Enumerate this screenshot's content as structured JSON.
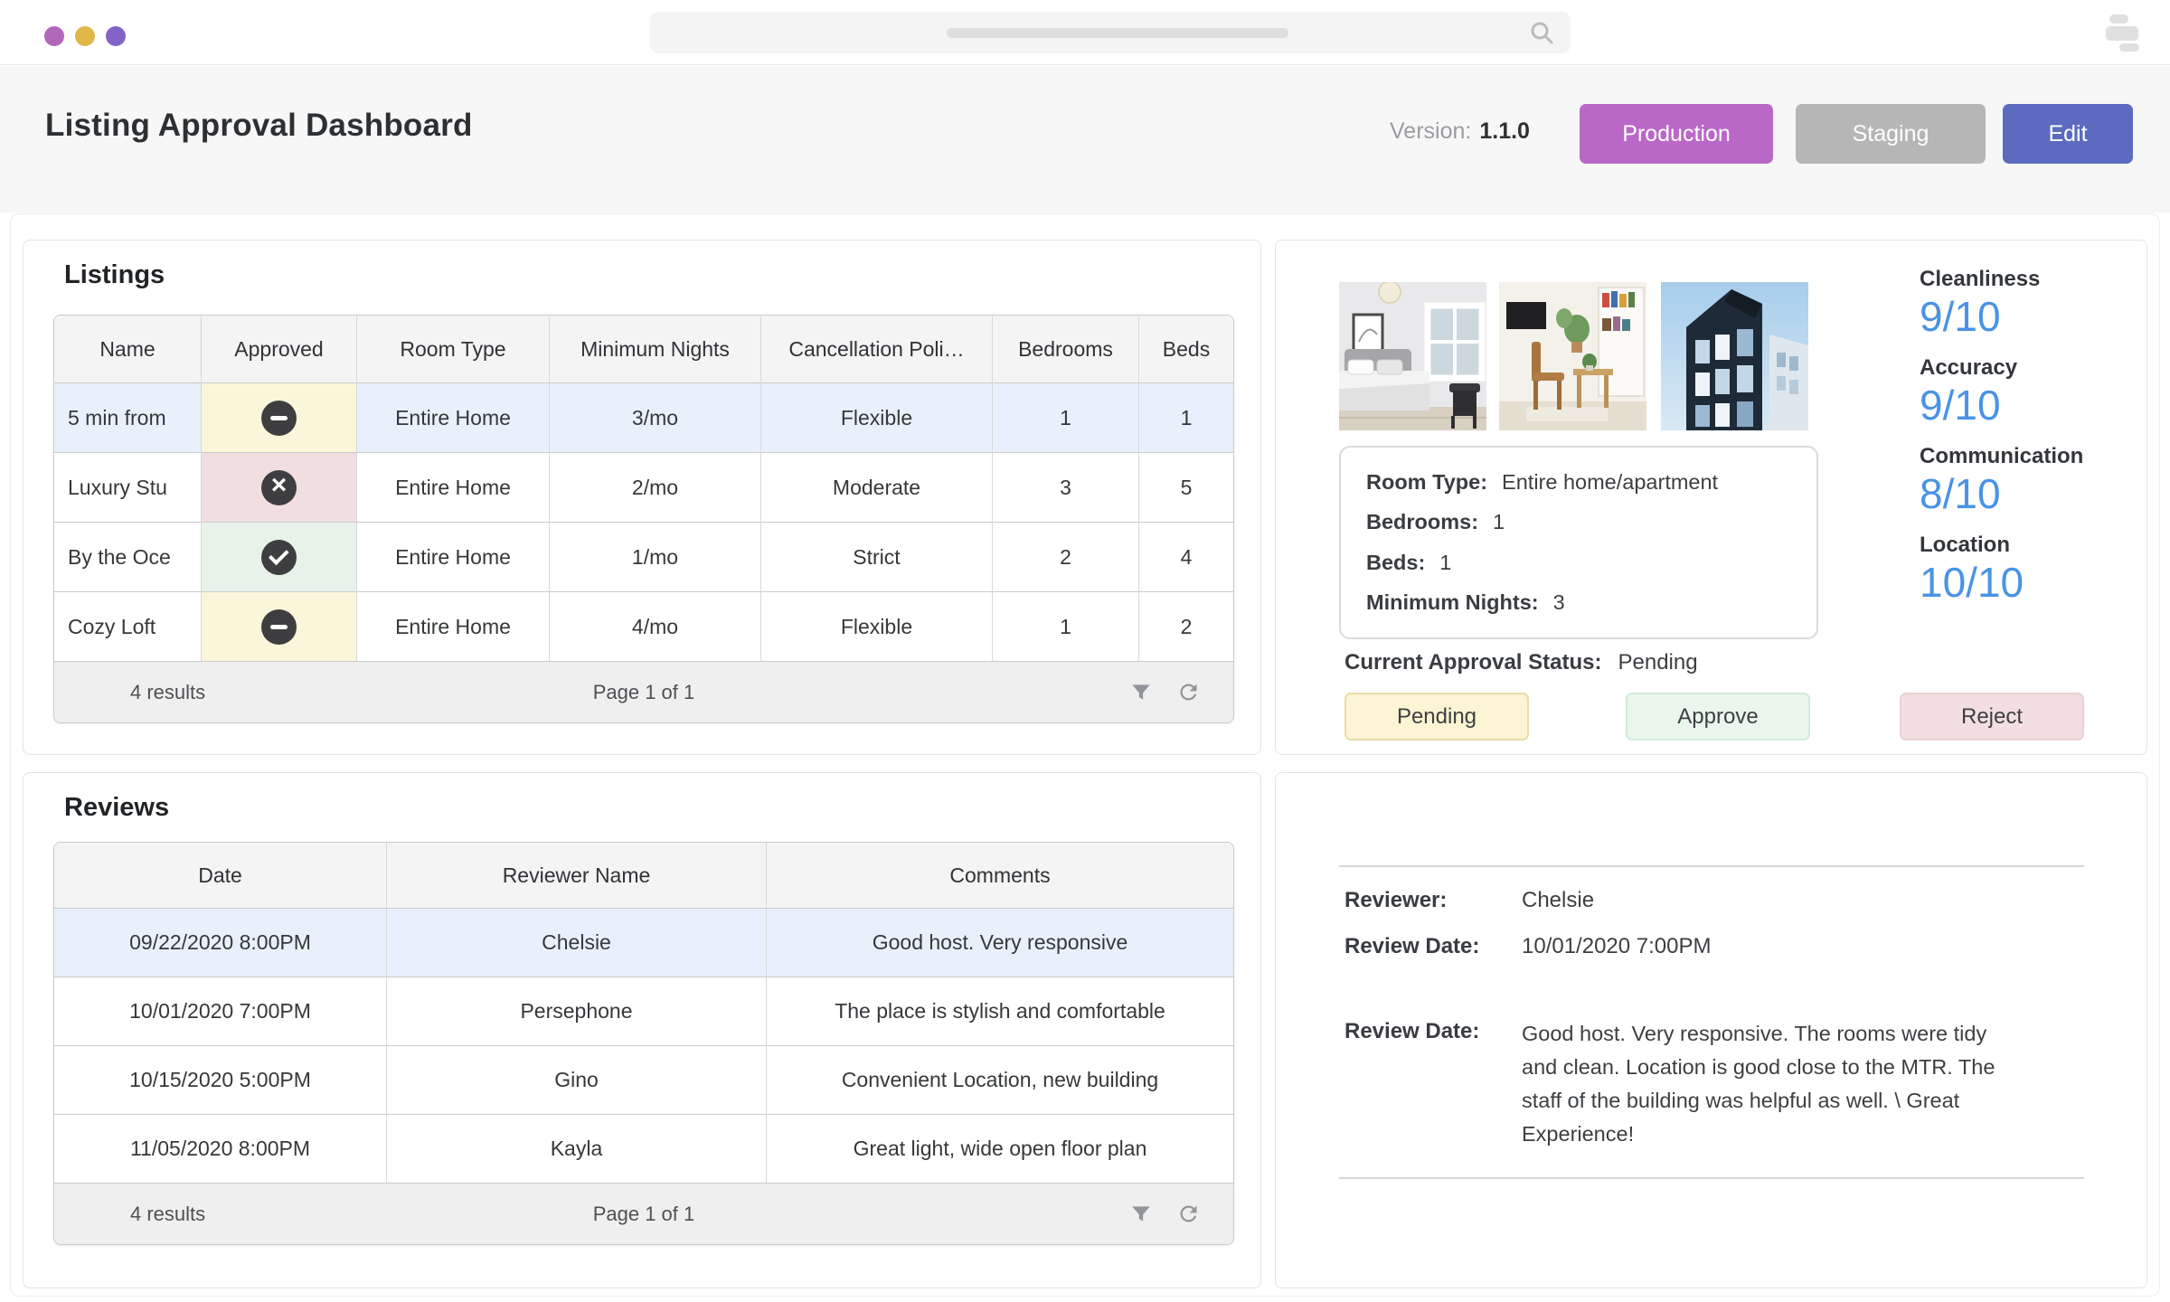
{
  "window": {
    "traffic_light_colors": [
      "#b168b8",
      "#e1b74a",
      "#8463c6"
    ],
    "search": {
      "value": "",
      "placeholder": ""
    }
  },
  "header": {
    "title": "Listing Approval Dashboard",
    "version_label": "Version:",
    "version_value": "1.1.0",
    "buttons": [
      {
        "label": "Production",
        "color": "#ba68c8"
      },
      {
        "label": "Staging",
        "color": "#b6b6b6"
      },
      {
        "label": "Edit",
        "color": "#5c6bc0"
      }
    ]
  },
  "listings": {
    "title": "Listings",
    "columns": [
      "Name",
      "Approved",
      "Room Type",
      "Minimum Nights",
      "Cancellation Poli…",
      "Bedrooms",
      "Beds"
    ],
    "rows": [
      {
        "name": "5 min from",
        "approved": "pending",
        "room_type": "Entire Home",
        "minimum_nights": "3/mo",
        "cancellation": "Flexible",
        "bedrooms": "1",
        "beds": "1",
        "selected": true
      },
      {
        "name": "Luxury Stu",
        "approved": "rejected",
        "room_type": "Entire Home",
        "minimum_nights": "2/mo",
        "cancellation": "Moderate",
        "bedrooms": "3",
        "beds": "5",
        "selected": false
      },
      {
        "name": "By the Oce",
        "approved": "approved",
        "room_type": "Entire Home",
        "minimum_nights": "1/mo",
        "cancellation": "Strict",
        "bedrooms": "2",
        "beds": "4",
        "selected": false
      },
      {
        "name": "Cozy Loft",
        "approved": "pending",
        "room_type": "Entire Home",
        "minimum_nights": "4/mo",
        "cancellation": "Flexible",
        "bedrooms": "1",
        "beds": "2",
        "selected": false
      }
    ],
    "footer": {
      "results": "4 results",
      "page": "Page 1 of 1"
    }
  },
  "reviews": {
    "title": "Reviews",
    "columns": [
      "Date",
      "Reviewer Name",
      "Comments"
    ],
    "rows": [
      {
        "date": "09/22/2020 8:00PM",
        "reviewer": "Chelsie",
        "comments": "Good host. Very responsive",
        "selected": true
      },
      {
        "date": "10/01/2020 7:00PM",
        "reviewer": "Persephone",
        "comments": "The place is stylish and comfortable",
        "selected": false
      },
      {
        "date": "10/15/2020 5:00PM",
        "reviewer": "Gino",
        "comments": "Convenient Location, new building",
        "selected": false
      },
      {
        "date": "11/05/2020 8:00PM",
        "reviewer": "Kayla",
        "comments": "Great light, wide open floor plan",
        "selected": false
      }
    ],
    "footer": {
      "results": "4 results",
      "page": "Page 1 of 1"
    }
  },
  "detail": {
    "photos": [
      "bedroom",
      "living-room",
      "building-exterior"
    ],
    "ratings": [
      {
        "label": "Cleanliness",
        "value": "9/10"
      },
      {
        "label": "Accuracy",
        "value": "9/10"
      },
      {
        "label": "Communication",
        "value": "8/10"
      },
      {
        "label": "Location",
        "value": "10/10"
      }
    ],
    "info": [
      {
        "label": "Room Type:",
        "value": "Entire home/apartment"
      },
      {
        "label": "Bedrooms:",
        "value": "1"
      },
      {
        "label": "Beds:",
        "value": "1"
      },
      {
        "label": "Minimum Nights:",
        "value": "3"
      }
    ],
    "status_label": "Current Approval Status:",
    "status_value": "Pending",
    "actions": [
      {
        "label": "Pending",
        "bg": "#fcf4d2"
      },
      {
        "label": "Approve",
        "bg": "#e9f7ec"
      },
      {
        "label": "Reject",
        "bg": "#f3dfe1"
      }
    ]
  },
  "review_detail": {
    "reviewer_label": "Reviewer:",
    "reviewer_value": "Chelsie",
    "date_label": "Review Date:",
    "date_value": "10/01/2020 7:00PM",
    "comment_label": "Review Date:",
    "comment_value": "Good host. Very responsive. The rooms were tidy and clean. Location is good close to the MTR. The staff of the building was helpful as well. \\ Great Experience!"
  },
  "colors": {
    "accent_blue": "#4a93e6",
    "selected_row": "#e8f1fb",
    "status_pending_bg": "#fbf5da",
    "status_rejected_bg": "#f1dee1",
    "status_approved_bg": "#e7f3e9",
    "status_icon_circle": "#3e3e40"
  },
  "icons": {
    "status_pending": "minus-circle-icon",
    "status_rejected": "x-circle-icon",
    "status_approved": "check-circle-icon",
    "footer": [
      "filter-icon",
      "refresh-icon"
    ],
    "topbar": [
      "search-icon",
      "menu-bars-icon"
    ]
  }
}
